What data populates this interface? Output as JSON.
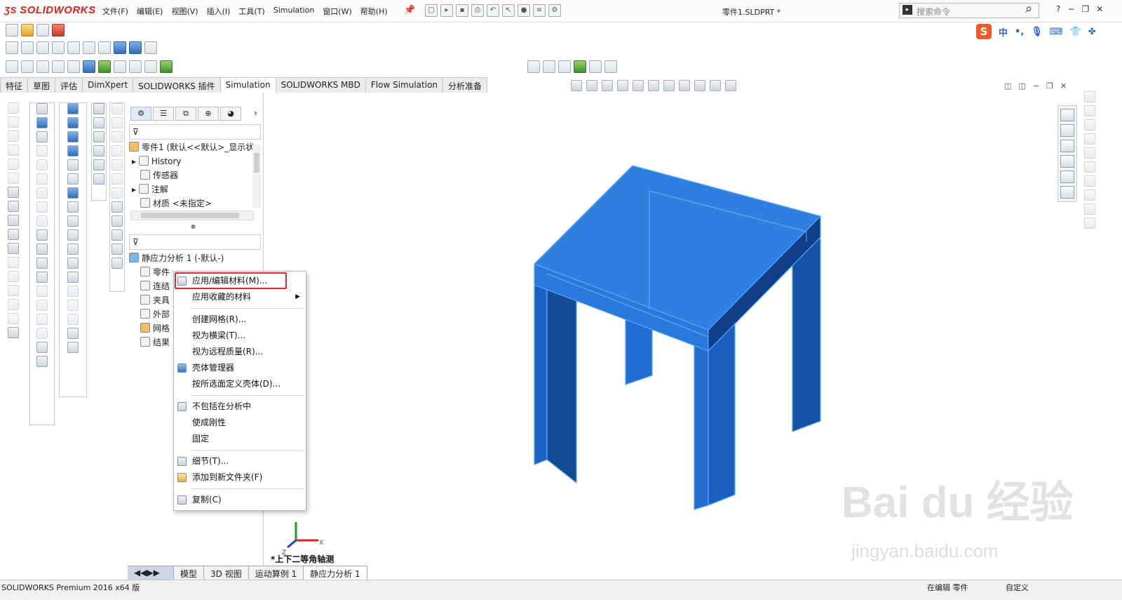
{
  "app": {
    "logo": "SOLIDWORKS",
    "document_title": "零件1.SLDPRT *"
  },
  "menu": [
    "文件(F)",
    "编辑(E)",
    "视图(V)",
    "插入(I)",
    "工具(T)",
    "Simulation",
    "窗口(W)",
    "帮助(H)"
  ],
  "search": {
    "placeholder": "搜索命令"
  },
  "window_controls": [
    "?",
    "−",
    "❐",
    "✕"
  ],
  "sogou": {
    "mode": "中"
  },
  "command_tabs": [
    {
      "label": "特征"
    },
    {
      "label": "草图"
    },
    {
      "label": "评估"
    },
    {
      "label": "DimXpert"
    },
    {
      "label": "SOLIDWORKS 插件"
    },
    {
      "label": "Simulation",
      "active": true
    },
    {
      "label": "SOLIDWORKS MBD"
    },
    {
      "label": "Flow Simulation"
    },
    {
      "label": "分析准备"
    }
  ],
  "feature_tree": {
    "root": "零件1 (默认<<默认>_显示状",
    "items": [
      "History",
      "传感器",
      "注解",
      "材质 <未指定>"
    ]
  },
  "simulation_tree": {
    "root": "静应力分析 1 (-默认-)",
    "items": [
      "零件",
      "连结",
      "夹具",
      "外部",
      "网格",
      "结果"
    ]
  },
  "context_menu": {
    "items": [
      {
        "label": "应用/编辑材料(M)...",
        "highlighted": true
      },
      {
        "label": "应用收藏的材料",
        "submenu": true
      },
      {
        "label": "创建网格(R)..."
      },
      {
        "label": "视为横梁(T)..."
      },
      {
        "label": "视为远程质量(R)..."
      },
      {
        "label": "壳体管理器"
      },
      {
        "label": "按所选面定义壳体(D)..."
      },
      {
        "label": "不包括在分析中"
      },
      {
        "label": "使成刚性"
      },
      {
        "label": "固定"
      },
      {
        "label": "细节(T)..."
      },
      {
        "label": "添加到新文件夹(F)"
      },
      {
        "label": "复制(C)"
      }
    ]
  },
  "viewport": {
    "view_name": "*上下二等角轴测",
    "axis_x": "X",
    "axis_z": "Z",
    "model_color": "#1f6fd1",
    "highlight_color": "#e0282e"
  },
  "bottom_tabs": [
    {
      "label": "模型"
    },
    {
      "label": "3D 视图"
    },
    {
      "label": "运动算例 1"
    },
    {
      "label": "静应力分析 1",
      "active": true
    }
  ],
  "status": {
    "left": "SOLIDWORKS Premium 2016 x64 版",
    "editing": "在编辑 零件",
    "custom": "自定义"
  },
  "watermark": {
    "brand": "Bai du 经验",
    "url": "jingyan.baidu.com"
  }
}
